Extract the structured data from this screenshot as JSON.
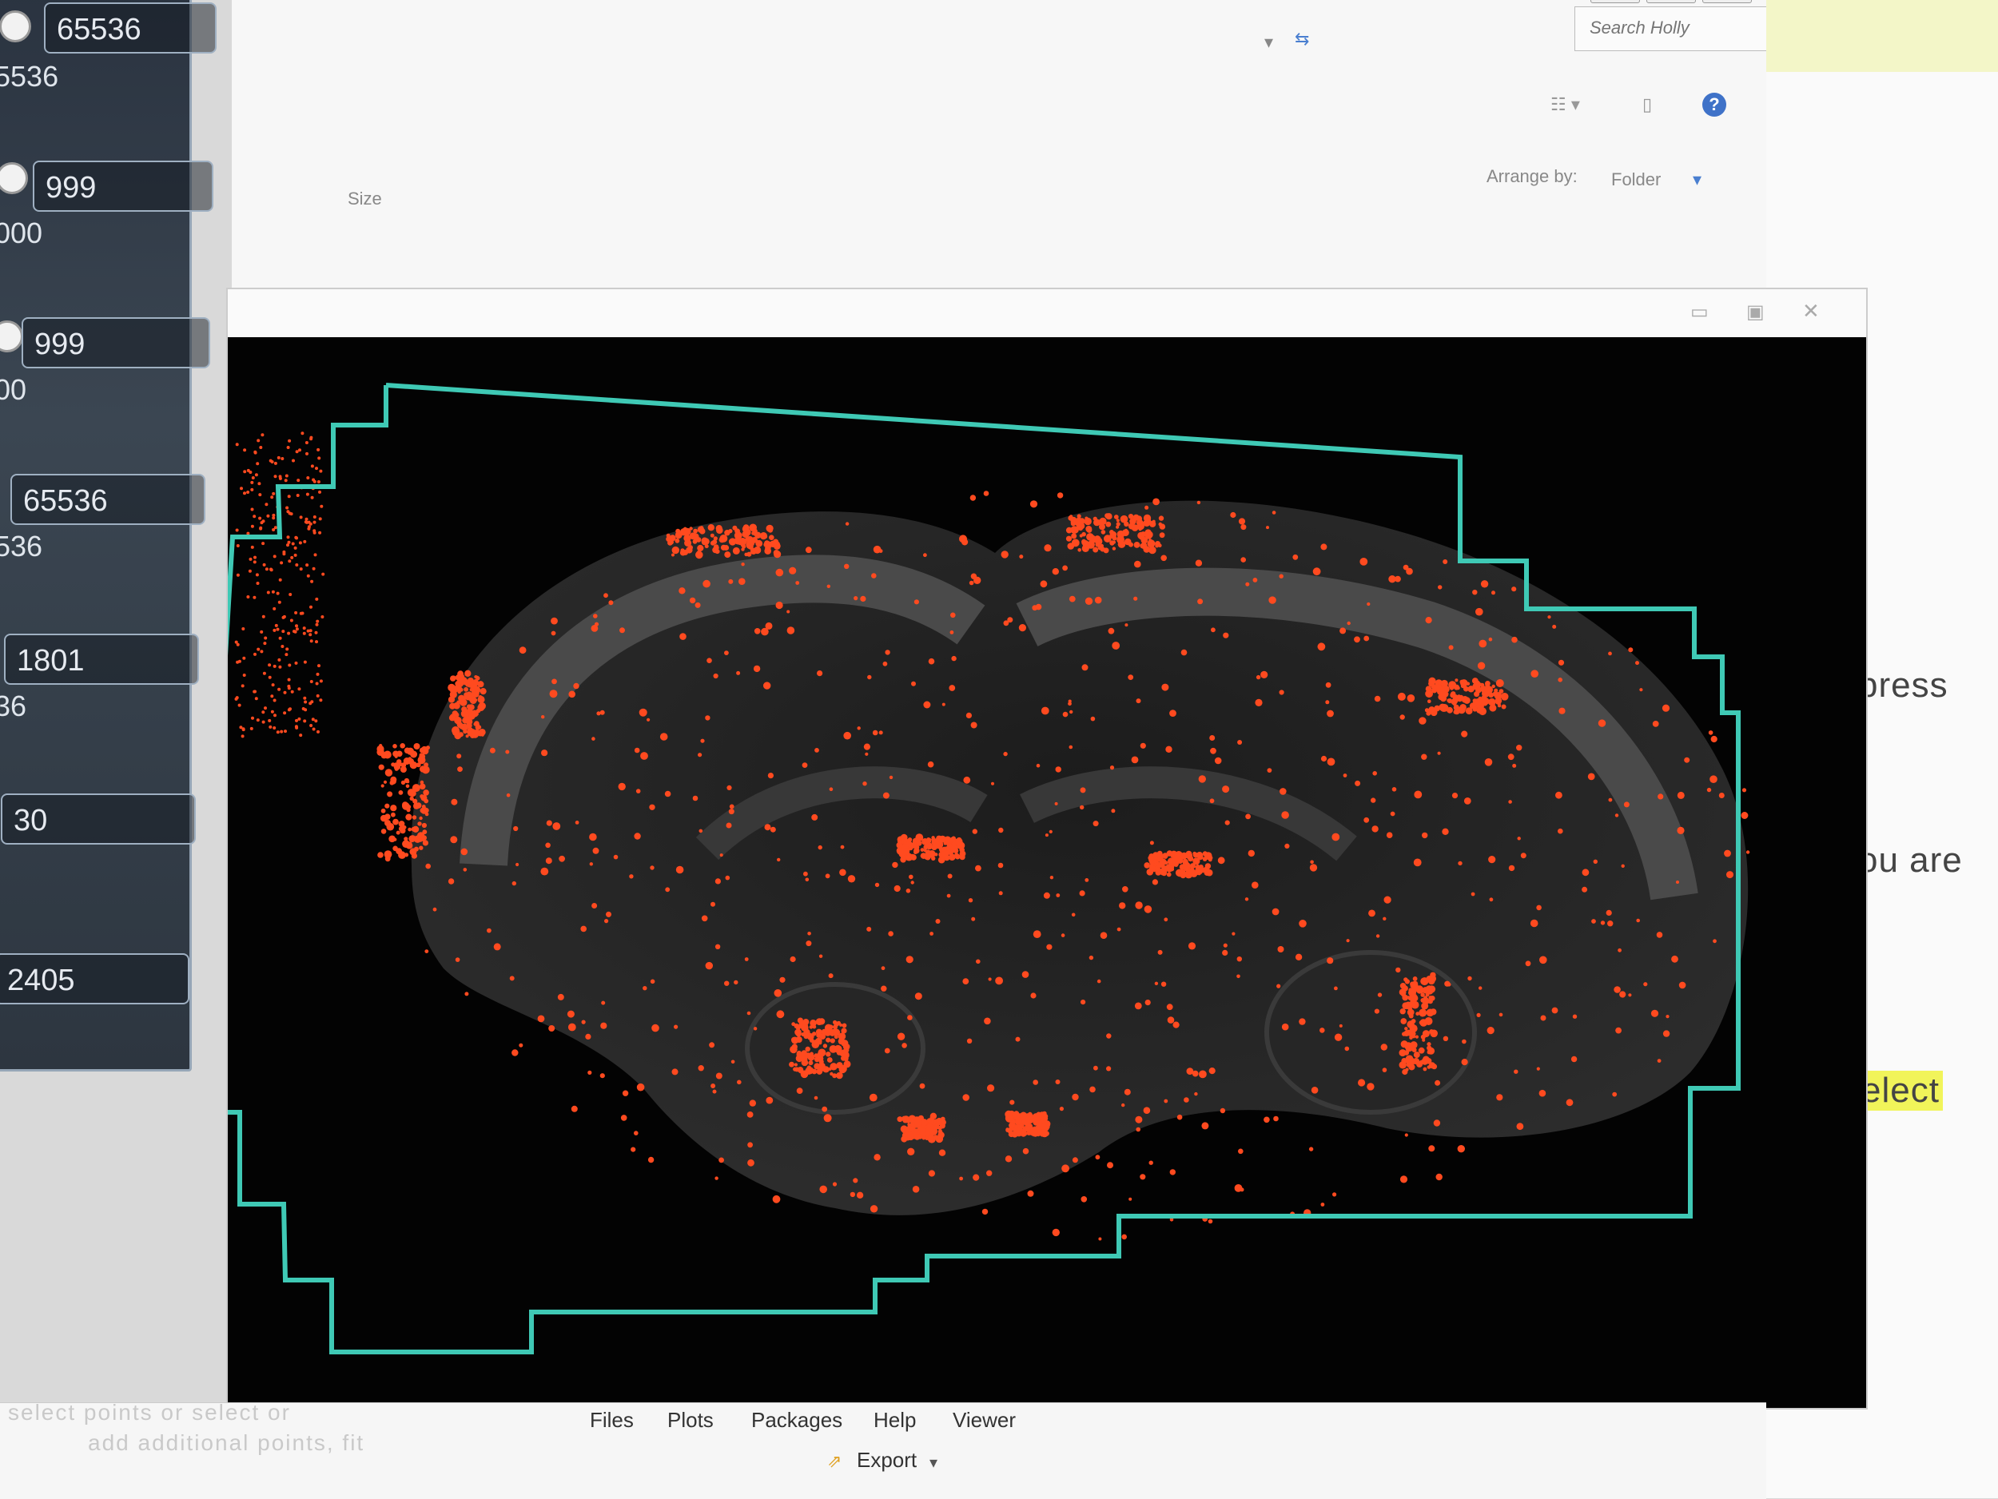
{
  "explorer": {
    "search_placeholder": "Search Holly",
    "size_header": "Size",
    "arrange_by_label": "Arrange by:",
    "arrange_by_value": "Folder"
  },
  "parameter_panel": {
    "fields": [
      {
        "value": "65536",
        "sublabel": "5536"
      },
      {
        "value": "999",
        "sublabel": "000"
      },
      {
        "value": "999",
        "sublabel": "00"
      },
      {
        "value": "65536",
        "sublabel": "536"
      },
      {
        "value": "1801",
        "sublabel": "36"
      },
      {
        "value": "30",
        "sublabel": ""
      },
      {
        "value": "2405",
        "sublabel": ""
      }
    ]
  },
  "right_document": {
    "line1": "press",
    "line2": "ou are",
    "line3": "elect"
  },
  "bottom_tabs": {
    "files": "Files",
    "plots": "Plots",
    "packages": "Packages",
    "help": "Help",
    "viewer": "Viewer",
    "export": "Export"
  },
  "bottom_console": {
    "line1": "select points or select or",
    "line2": "add additional points, fit"
  },
  "colors": {
    "roi_outline": "#3fc9b5",
    "signal": "#ff4a1f",
    "tissue": "#3a3a3a",
    "highlight": "#f1f45a"
  }
}
